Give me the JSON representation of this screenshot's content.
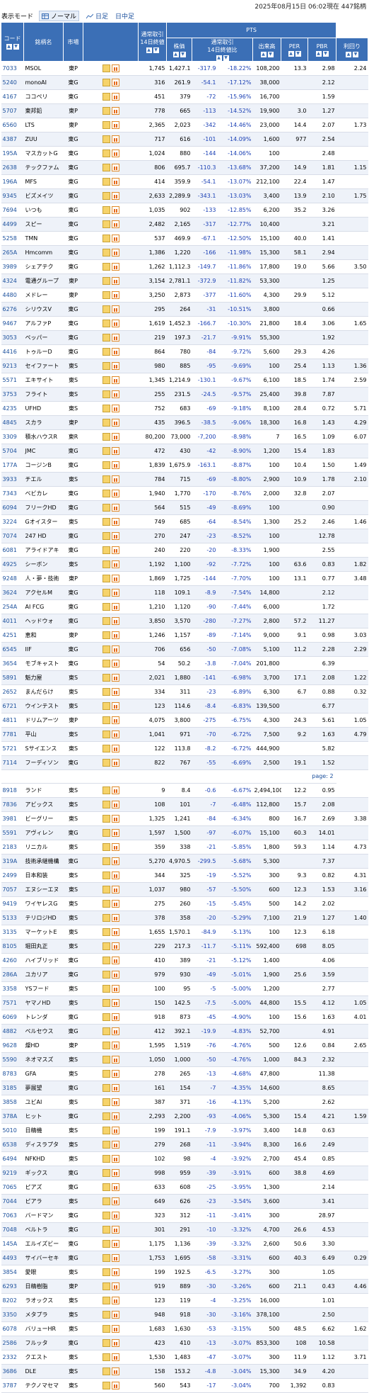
{
  "header": {
    "status": "2025年08月15日 06:02現在 447銘柄"
  },
  "mode": {
    "label": "表示モード",
    "normal": "ノーマル",
    "daily": "日足",
    "intraday": "日中足"
  },
  "columns": {
    "code": "コード",
    "name": "銘柄名",
    "market": "市場",
    "regular": "通常取引\n14日終値",
    "pts": "PTS",
    "price": "株価",
    "change": "通常取引\n14日終値比",
    "volume": "出来高",
    "per": "PER",
    "pbr": "PBR",
    "yield": "利回り"
  },
  "pager": {
    "label": "page: 2"
  },
  "rows": [
    [
      "7033",
      "MSOL",
      "東P",
      "1,745",
      "1,427.1",
      "-317.9",
      "-18.22%",
      "108,200",
      "13.3",
      "2.98",
      "2.24"
    ],
    [
      "5240",
      "monoAI",
      "東G",
      "316",
      "261.9",
      "-54.1",
      "-17.12%",
      "38,000",
      "",
      "2.12",
      ""
    ],
    [
      "4167",
      "ココペリ",
      "東G",
      "451",
      "379",
      "-72",
      "-15.96%",
      "16,700",
      "",
      "1.59",
      ""
    ],
    [
      "5707",
      "東邦鉛",
      "東P",
      "778",
      "665",
      "-113",
      "-14.52%",
      "19,900",
      "3.0",
      "1.27",
      ""
    ],
    [
      "6560",
      "LTS",
      "東P",
      "2,365",
      "2,023",
      "-342",
      "-14.46%",
      "23,000",
      "14.4",
      "2.07",
      "1.73"
    ],
    [
      "4387",
      "ZUU",
      "東G",
      "717",
      "616",
      "-101",
      "-14.09%",
      "1,600",
      "977",
      "2.54",
      ""
    ],
    [
      "195A",
      "マスカットG",
      "東G",
      "1,024",
      "880",
      "-144",
      "-14.06%",
      "100",
      "",
      "2.48",
      ""
    ],
    [
      "2638",
      "テックファム",
      "東G",
      "806",
      "695.7",
      "-110.3",
      "-13.68%",
      "37,200",
      "14.9",
      "1.81",
      "1.15"
    ],
    [
      "196A",
      "MFS",
      "東G",
      "414",
      "359.9",
      "-54.1",
      "-13.07%",
      "212,100",
      "22.4",
      "1.47",
      ""
    ],
    [
      "9345",
      "ビズメイツ",
      "東G",
      "2,633",
      "2,289.9",
      "-343.1",
      "-13.03%",
      "3,400",
      "13.9",
      "2.10",
      "1.75"
    ],
    [
      "7694",
      "いつも",
      "東G",
      "1,035",
      "902",
      "-133",
      "-12.85%",
      "6,200",
      "35.2",
      "3.26",
      ""
    ],
    [
      "4499",
      "スピー",
      "東G",
      "2,482",
      "2,165",
      "-317",
      "-12.77%",
      "10,400",
      "",
      "3.21",
      ""
    ],
    [
      "5258",
      "TMN",
      "東G",
      "537",
      "469.9",
      "-67.1",
      "-12.50%",
      "15,100",
      "40.0",
      "1.41",
      ""
    ],
    [
      "265A",
      "Hmcomm",
      "東G",
      "1,386",
      "1,220",
      "-166",
      "-11.98%",
      "15,300",
      "58.1",
      "2.94",
      ""
    ],
    [
      "3989",
      "シェアテク",
      "東G",
      "1,262",
      "1,112.3",
      "-149.7",
      "-11.86%",
      "17,800",
      "19.0",
      "5.66",
      "3.50"
    ],
    [
      "4324",
      "電通グループ",
      "東P",
      "3,154",
      "2,781.1",
      "-372.9",
      "-11.82%",
      "53,300",
      "",
      "1.25",
      ""
    ],
    [
      "4480",
      "メドレー",
      "東P",
      "3,250",
      "2,873",
      "-377",
      "-11.60%",
      "4,300",
      "29.9",
      "5.12",
      ""
    ],
    [
      "6276",
      "シリウスV",
      "東G",
      "295",
      "264",
      "-31",
      "-10.51%",
      "3,800",
      "",
      "0.66",
      ""
    ],
    [
      "9467",
      "アルファP",
      "東G",
      "1,619",
      "1,452.3",
      "-166.7",
      "-10.30%",
      "21,800",
      "18.4",
      "3.06",
      "1.65"
    ],
    [
      "3053",
      "ペッパー",
      "東G",
      "219",
      "197.3",
      "-21.7",
      "-9.91%",
      "55,300",
      "",
      "1.92",
      ""
    ],
    [
      "4416",
      "トゥルーD",
      "東G",
      "864",
      "780",
      "-84",
      "-9.72%",
      "5,600",
      "29.3",
      "4.26",
      ""
    ],
    [
      "9213",
      "セイファート",
      "東S",
      "980",
      "885",
      "-95",
      "-9.69%",
      "100",
      "25.4",
      "1.13",
      "1.36"
    ],
    [
      "5571",
      "エキサイト",
      "東S",
      "1,345",
      "1,214.9",
      "-130.1",
      "-9.67%",
      "6,100",
      "18.5",
      "1.74",
      "2.59"
    ],
    [
      "3753",
      "フライト",
      "東S",
      "255",
      "231.5",
      "-24.5",
      "-9.57%",
      "25,400",
      "39.8",
      "7.87",
      ""
    ],
    [
      "4235",
      "UFHD",
      "東S",
      "752",
      "683",
      "-69",
      "-9.18%",
      "8,100",
      "28.4",
      "0.72",
      "5.71"
    ],
    [
      "4845",
      "スカラ",
      "東P",
      "435",
      "396.5",
      "-38.5",
      "-9.06%",
      "18,300",
      "16.8",
      "1.43",
      "4.29"
    ],
    [
      "3309",
      "積水ハウスR",
      "東R",
      "80,200",
      "73,000",
      "-7,200",
      "-8.98%",
      "7",
      "16.5",
      "1.09",
      "6.07"
    ],
    [
      "5704",
      "JMC",
      "東G",
      "472",
      "430",
      "-42",
      "-8.90%",
      "1,200",
      "15.4",
      "1.83",
      ""
    ],
    [
      "177A",
      "コージンB",
      "東G",
      "1,839",
      "1,675.9",
      "-163.1",
      "-8.87%",
      "100",
      "10.4",
      "1.50",
      "1.49"
    ],
    [
      "3933",
      "チエル",
      "東S",
      "784",
      "715",
      "-69",
      "-8.80%",
      "2,900",
      "10.9",
      "1.78",
      "2.10"
    ],
    [
      "7343",
      "ベビカレ",
      "東G",
      "1,940",
      "1,770",
      "-170",
      "-8.76%",
      "2,000",
      "32.8",
      "2.07",
      ""
    ],
    [
      "6094",
      "フリークHD",
      "東G",
      "564",
      "515",
      "-49",
      "-8.69%",
      "100",
      "",
      "0.90",
      ""
    ],
    [
      "3224",
      "Gオイスター",
      "東S",
      "749",
      "685",
      "-64",
      "-8.54%",
      "1,300",
      "25.2",
      "2.46",
      "1.46"
    ],
    [
      "7074",
      "247 HD",
      "東G",
      "270",
      "247",
      "-23",
      "-8.52%",
      "100",
      "",
      "12.78",
      ""
    ],
    [
      "6081",
      "アライドアキ",
      "東G",
      "240",
      "220",
      "-20",
      "-8.33%",
      "1,900",
      "",
      "2.55",
      ""
    ],
    [
      "4925",
      "シーボン",
      "東S",
      "1,192",
      "1,100",
      "-92",
      "-7.72%",
      "100",
      "63.6",
      "0.83",
      "1.82"
    ],
    [
      "9248",
      "人・夢・技術",
      "東P",
      "1,869",
      "1,725",
      "-144",
      "-7.70%",
      "100",
      "13.1",
      "0.77",
      "3.48"
    ],
    [
      "3624",
      "アクセルM",
      "東G",
      "118",
      "109.1",
      "-8.9",
      "-7.54%",
      "14,800",
      "",
      "2.12",
      ""
    ],
    [
      "254A",
      "AI FCG",
      "東G",
      "1,210",
      "1,120",
      "-90",
      "-7.44%",
      "6,000",
      "",
      "1.72",
      ""
    ],
    [
      "4011",
      "ヘッドウォ",
      "東G",
      "3,850",
      "3,570",
      "-280",
      "-7.27%",
      "2,800",
      "57.2",
      "11.27",
      ""
    ],
    [
      "4251",
      "恵和",
      "東P",
      "1,246",
      "1,157",
      "-89",
      "-7.14%",
      "9,000",
      "9.1",
      "0.98",
      "3.03"
    ],
    [
      "6545",
      "IIF",
      "東G",
      "706",
      "656",
      "-50",
      "-7.08%",
      "5,100",
      "11.2",
      "2.28",
      "2.29"
    ],
    [
      "3654",
      "モブキャスト",
      "東G",
      "54",
      "50.2",
      "-3.8",
      "-7.04%",
      "201,800",
      "",
      "6.39",
      ""
    ],
    [
      "5891",
      "魁力屋",
      "東S",
      "2,021",
      "1,880",
      "-141",
      "-6.98%",
      "3,700",
      "17.1",
      "2.08",
      "1.22"
    ],
    [
      "2652",
      "まんだらけ",
      "東S",
      "334",
      "311",
      "-23",
      "-6.89%",
      "6,300",
      "6.7",
      "0.88",
      "0.32"
    ],
    [
      "6721",
      "ウインテスト",
      "東S",
      "123",
      "114.6",
      "-8.4",
      "-6.83%",
      "139,500",
      "",
      "6.77",
      ""
    ],
    [
      "4811",
      "ドリムアーツ",
      "東P",
      "4,075",
      "3,800",
      "-275",
      "-6.75%",
      "4,300",
      "24.3",
      "5.61",
      "1.05"
    ],
    [
      "7781",
      "平山",
      "東S",
      "1,041",
      "971",
      "-70",
      "-6.72%",
      "7,500",
      "9.2",
      "1.63",
      "4.79"
    ],
    [
      "5721",
      "Sサイエンス",
      "東S",
      "122",
      "113.8",
      "-8.2",
      "-6.72%",
      "444,900",
      "",
      "5.82",
      ""
    ],
    [
      "7114",
      "フーディソン",
      "東G",
      "822",
      "767",
      "-55",
      "-6.69%",
      "2,500",
      "19.1",
      "1.52",
      ""
    ],
    [
      "__PAGE__"
    ],
    [
      "8918",
      "ランド",
      "東S",
      "9",
      "8.4",
      "-0.6",
      "-6.67%",
      "2,494,100",
      "12.2",
      "0.95",
      ""
    ],
    [
      "7836",
      "アビックス",
      "東S",
      "108",
      "101",
      "-7",
      "-6.48%",
      "112,800",
      "15.7",
      "2.08",
      ""
    ],
    [
      "3981",
      "ビーグリー",
      "東S",
      "1,325",
      "1,241",
      "-84",
      "-6.34%",
      "800",
      "16.7",
      "2.69",
      "3.38"
    ],
    [
      "5591",
      "アヴィレン",
      "東G",
      "1,597",
      "1,500",
      "-97",
      "-6.07%",
      "15,100",
      "60.3",
      "14.01",
      ""
    ],
    [
      "2183",
      "リニカル",
      "東S",
      "359",
      "338",
      "-21",
      "-5.85%",
      "1,800",
      "59.3",
      "1.14",
      "4.73"
    ],
    [
      "319A",
      "技術承継機構",
      "東G",
      "5,270",
      "4,970.5",
      "-299.5",
      "-5.68%",
      "5,300",
      "",
      "7.37",
      ""
    ],
    [
      "2499",
      "日本和装",
      "東S",
      "344",
      "325",
      "-19",
      "-5.52%",
      "300",
      "9.3",
      "0.82",
      "4.31"
    ],
    [
      "7057",
      "エヌシーエヌ",
      "東S",
      "1,037",
      "980",
      "-57",
      "-5.50%",
      "600",
      "12.3",
      "1.53",
      "3.16"
    ],
    [
      "9419",
      "ワイヤレスG",
      "東S",
      "275",
      "260",
      "-15",
      "-5.45%",
      "500",
      "14.2",
      "2.02",
      ""
    ],
    [
      "5133",
      "テリロジHD",
      "東S",
      "378",
      "358",
      "-20",
      "-5.29%",
      "7,100",
      "21.9",
      "1.27",
      "1.40"
    ],
    [
      "3135",
      "マーケットE",
      "東S",
      "1,655",
      "1,570.1",
      "-84.9",
      "-5.13%",
      "100",
      "12.3",
      "6.18",
      ""
    ],
    [
      "8105",
      "堀田丸正",
      "東S",
      "229",
      "217.3",
      "-11.7",
      "-5.11%",
      "592,400",
      "698",
      "8.05",
      ""
    ],
    [
      "4260",
      "ハイブリッド",
      "東G",
      "410",
      "389",
      "-21",
      "-5.12%",
      "1,400",
      "",
      "4.06",
      ""
    ],
    [
      "286A",
      "ユカリア",
      "東G",
      "979",
      "930",
      "-49",
      "-5.01%",
      "1,900",
      "25.6",
      "3.59",
      ""
    ],
    [
      "3358",
      "YSフード",
      "東S",
      "100",
      "95",
      "-5",
      "-5.00%",
      "1,200",
      "",
      "2.77",
      ""
    ],
    [
      "7571",
      "ヤマノHD",
      "東S",
      "150",
      "142.5",
      "-7.5",
      "-5.00%",
      "44,800",
      "15.5",
      "4.12",
      "1.05"
    ],
    [
      "6069",
      "トレンダ",
      "東G",
      "918",
      "873",
      "-45",
      "-4.90%",
      "100",
      "15.6",
      "1.63",
      "4.01"
    ],
    [
      "4882",
      "ペルセウス",
      "東G",
      "412",
      "392.1",
      "-19.9",
      "-4.83%",
      "52,700",
      "",
      "4.91",
      ""
    ],
    [
      "9628",
      "燦HD",
      "東P",
      "1,595",
      "1,519",
      "-76",
      "-4.76%",
      "500",
      "12.6",
      "0.84",
      "2.65"
    ],
    [
      "5590",
      "ネオマスズ",
      "東S",
      "1,050",
      "1,000",
      "-50",
      "-4.76%",
      "1,000",
      "84.3",
      "2.32",
      ""
    ],
    [
      "8783",
      "GFA",
      "東S",
      "278",
      "265",
      "-13",
      "-4.68%",
      "47,800",
      "",
      "11.38",
      ""
    ],
    [
      "3185",
      "夢展望",
      "東G",
      "161",
      "154",
      "-7",
      "-4.35%",
      "14,600",
      "",
      "8.65",
      ""
    ],
    [
      "3858",
      "ユビAI",
      "東S",
      "387",
      "371",
      "-16",
      "-4.13%",
      "5,200",
      "",
      "2.62",
      ""
    ],
    [
      "378A",
      "ヒット",
      "東G",
      "2,293",
      "2,200",
      "-93",
      "-4.06%",
      "5,300",
      "15.4",
      "4.21",
      "1.59"
    ],
    [
      "5010",
      "日精機",
      "東S",
      "199",
      "191.1",
      "-7.9",
      "-3.97%",
      "3,400",
      "14.8",
      "0.63",
      ""
    ],
    [
      "6538",
      "ディスラプタ",
      "東S",
      "279",
      "268",
      "-11",
      "-3.94%",
      "8,300",
      "16.6",
      "2.49",
      ""
    ],
    [
      "6494",
      "NFKHD",
      "東S",
      "102",
      "98",
      "-4",
      "-3.92%",
      "2,700",
      "45.4",
      "0.85",
      ""
    ],
    [
      "9219",
      "ギックス",
      "東G",
      "998",
      "959",
      "-39",
      "-3.91%",
      "600",
      "38.8",
      "4.69",
      ""
    ],
    [
      "7065",
      "ピアズ",
      "東G",
      "633",
      "608",
      "-25",
      "-3.95%",
      "1,300",
      "",
      "2.14",
      ""
    ],
    [
      "7044",
      "ピアラ",
      "東S",
      "649",
      "626",
      "-23",
      "-3.54%",
      "3,600",
      "",
      "3.41",
      ""
    ],
    [
      "7063",
      "バードマン",
      "東G",
      "323",
      "312",
      "-11",
      "-3.41%",
      "300",
      "",
      "28.97",
      ""
    ],
    [
      "7048",
      "ベルトラ",
      "東G",
      "301",
      "291",
      "-10",
      "-3.32%",
      "4,700",
      "26.6",
      "4.53",
      ""
    ],
    [
      "145A",
      "エルイズビー",
      "東G",
      "1,175",
      "1,136",
      "-39",
      "-3.32%",
      "2,600",
      "50.6",
      "3.30",
      ""
    ],
    [
      "4493",
      "サイバーセキ",
      "東G",
      "1,753",
      "1,695",
      "-58",
      "-3.31%",
      "600",
      "40.3",
      "6.49",
      "0.29"
    ],
    [
      "3854",
      "愛眼",
      "東S",
      "199",
      "192.5",
      "-6.5",
      "-3.27%",
      "300",
      "",
      "1.05",
      ""
    ],
    [
      "6293",
      "日精樹脂",
      "東P",
      "919",
      "889",
      "-30",
      "-3.26%",
      "600",
      "21.1",
      "0.43",
      "4.46"
    ],
    [
      "8202",
      "ラオックス",
      "東S",
      "123",
      "119",
      "-4",
      "-3.25%",
      "16,000",
      "",
      "1.01",
      ""
    ],
    [
      "3350",
      "メタプラ",
      "東S",
      "948",
      "918",
      "-30",
      "-3.16%",
      "378,100",
      "",
      "2.50",
      ""
    ],
    [
      "6078",
      "バリューHR",
      "東S",
      "1,683",
      "1,630",
      "-53",
      "-3.15%",
      "500",
      "48.5",
      "6.62",
      "1.62"
    ],
    [
      "2586",
      "フルッタ",
      "東G",
      "423",
      "410",
      "-13",
      "-3.07%",
      "853,300",
      "108",
      "10.58",
      ""
    ],
    [
      "2332",
      "クエスト",
      "東S",
      "1,530",
      "1,483",
      "-47",
      "-3.07%",
      "300",
      "11.9",
      "1.12",
      "3.71"
    ],
    [
      "3686",
      "DLE",
      "東S",
      "158",
      "153.2",
      "-4.8",
      "-3.04%",
      "15,300",
      "34.9",
      "4.20",
      ""
    ],
    [
      "3787",
      "テクノマセマ",
      "東S",
      "560",
      "543",
      "-17",
      "-3.04%",
      "700",
      "1,392",
      "0.83",
      ""
    ]
  ]
}
